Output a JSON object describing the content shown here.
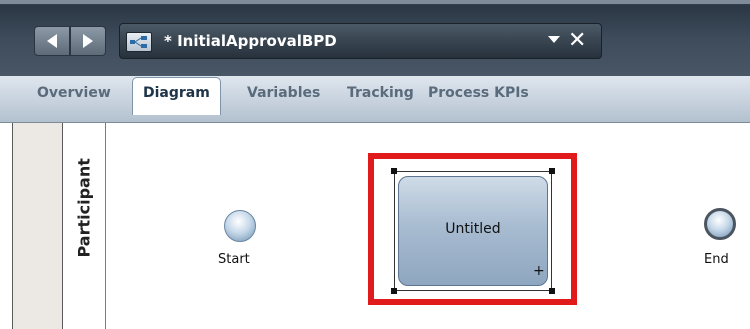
{
  "window": {
    "document_title": "* InitialApprovalBPD",
    "nav": {
      "back_icon": "chevron-left-icon",
      "forward_icon": "chevron-right-icon"
    },
    "close_glyph": "✕",
    "dropdown_glyph": "▼"
  },
  "tabs": [
    {
      "label": "Overview",
      "active": false
    },
    {
      "label": "Diagram",
      "active": true
    },
    {
      "label": "Variables",
      "active": false
    },
    {
      "label": "Tracking",
      "active": false
    },
    {
      "label": "Process KPIs",
      "active": false
    }
  ],
  "diagram": {
    "lane_label": "Participant",
    "start_event_label": "Start",
    "task_label": "Untitled",
    "task_expand_glyph": "+",
    "end_event_label": "End",
    "highlight_color": "#e11b1b"
  }
}
